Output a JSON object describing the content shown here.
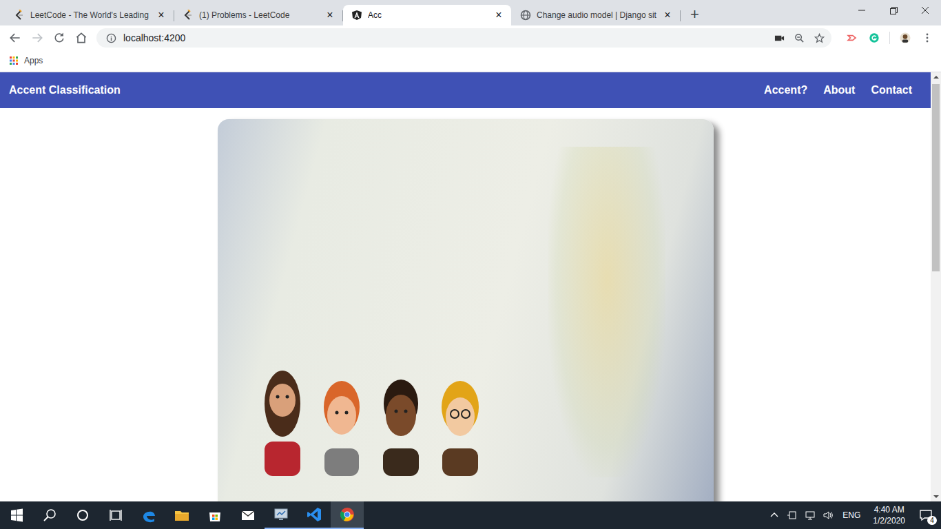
{
  "browser": {
    "tabs": [
      {
        "label": "LeetCode - The World's Leading",
        "selected": false,
        "kind": "leetcode"
      },
      {
        "label": "(1) Problems - LeetCode",
        "selected": false,
        "kind": "leetcode"
      },
      {
        "label": "Acc",
        "selected": true,
        "kind": "angular"
      },
      {
        "label": "Change audio model | Django sit",
        "selected": false,
        "kind": "globe"
      }
    ],
    "close": "×",
    "new_tab": "+",
    "address": "localhost:4200",
    "bookmarks": [
      "Apps"
    ]
  },
  "app": {
    "brand": "Accent Classification",
    "nav": [
      "Accent?",
      "About",
      "Contact"
    ]
  },
  "taskbar": {
    "apps": [
      {
        "kind": "edge",
        "running": false,
        "selected": false
      },
      {
        "kind": "explorer",
        "running": false,
        "selected": false
      },
      {
        "kind": "store",
        "running": false,
        "selected": false
      },
      {
        "kind": "mail",
        "running": false,
        "selected": false
      },
      {
        "kind": "monitor",
        "running": true,
        "selected": false
      },
      {
        "kind": "vscode",
        "running": true,
        "selected": false
      },
      {
        "kind": "chrome",
        "running": true,
        "selected": true
      }
    ],
    "language": "ENG",
    "time": "4:40 AM",
    "date": "1/2/2020",
    "notifications": "4"
  }
}
